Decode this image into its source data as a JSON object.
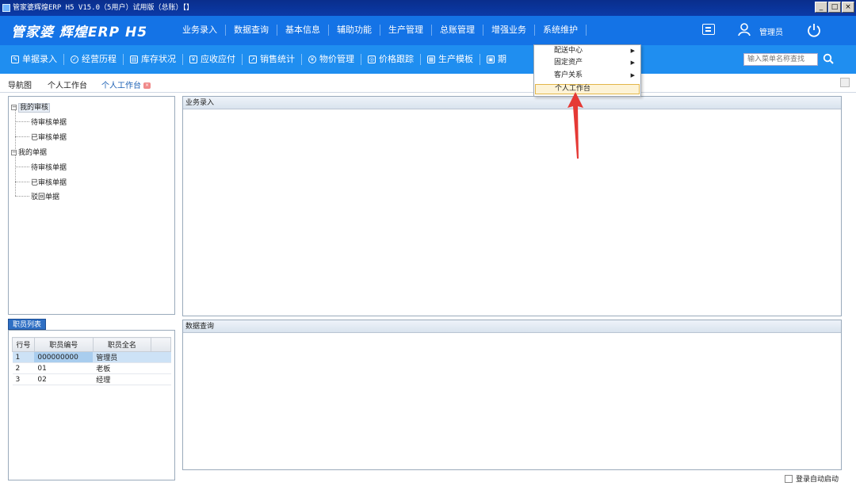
{
  "window": {
    "title": "管家婆辉煌ERP H5 V15.0（5用户）试用版（总账）【】",
    "min": "_",
    "max": "□",
    "close": "×"
  },
  "brand": "管家婆 辉煌ERP H5",
  "main_menu": [
    "业务录入",
    "数据查询",
    "基本信息",
    "辅助功能",
    "生产管理",
    "总账管理",
    "增强业务",
    "系统维护"
  ],
  "user": {
    "label": "管理员"
  },
  "toolbar": {
    "items": [
      {
        "icon": "edit-icon",
        "label": "单据录入"
      },
      {
        "icon": "check-circle-icon",
        "label": "经营历程"
      },
      {
        "icon": "calendar-icon",
        "label": "库存状况"
      },
      {
        "icon": "ledger-icon",
        "label": "应收应付"
      },
      {
        "icon": "chart-icon",
        "label": "销售统计"
      },
      {
        "icon": "price-icon",
        "label": "物价管理"
      },
      {
        "icon": "track-icon",
        "label": "价格跟踪"
      },
      {
        "icon": "doc-icon",
        "label": "生产模板"
      },
      {
        "icon": "period-icon",
        "label": "期"
      }
    ],
    "search_placeholder": "输入菜单名称查找"
  },
  "tabs": [
    {
      "label": "导航图"
    },
    {
      "label": "个人工作台"
    },
    {
      "label": "个人工作台",
      "active": true
    }
  ],
  "tree": {
    "my_review": {
      "label": "我的审核",
      "children": [
        "待审核单据",
        "已审核单据"
      ]
    },
    "my_docs": {
      "label": "我的单据",
      "children": [
        "待审核单据",
        "已审核单据",
        "驳回单据"
      ]
    }
  },
  "employee_tab": "职员列表",
  "employee_table": {
    "columns": [
      "行号",
      "职员编号",
      "职员全名"
    ],
    "rows": [
      {
        "no": "1",
        "code": "000000000",
        "name": "管理员"
      },
      {
        "no": "2",
        "code": "01",
        "name": "老板"
      },
      {
        "no": "3",
        "code": "02",
        "name": "经理"
      }
    ]
  },
  "sections": {
    "entry": "业务录入",
    "query": "数据查询"
  },
  "auto_login_label": "登录自动启动",
  "dropdown": {
    "items": [
      {
        "label": "配送中心",
        "submenu": true
      },
      {
        "label": "固定资产",
        "submenu": true
      },
      {
        "label": "客户关系",
        "submenu": true
      },
      {
        "label": "个人工作台",
        "submenu": false,
        "highlighted": true
      }
    ]
  },
  "colors": {
    "topbar": "#1473e6",
    "toolbar": "#1f8ef0",
    "title_bar": "#0a2e8c",
    "arrow": "#e53935",
    "highlight": "#fdf3d6"
  }
}
